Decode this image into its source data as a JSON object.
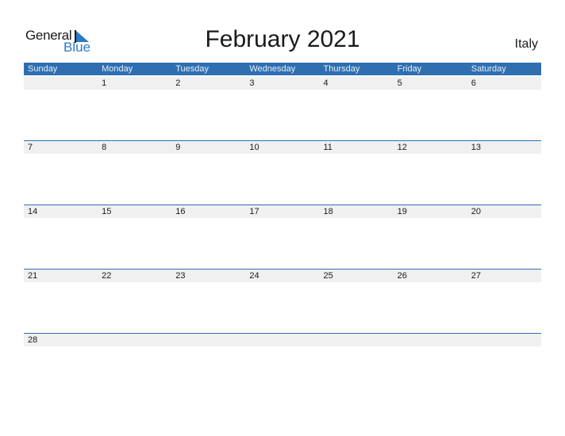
{
  "logo": {
    "general": "General",
    "blue": "Blue"
  },
  "title": "February 2021",
  "country": "Italy",
  "colors": {
    "header": "#2f6fb0",
    "band": "#f0f0f0",
    "logo_blue": "#2a79c4"
  },
  "weekdays": [
    "Sunday",
    "Monday",
    "Tuesday",
    "Wednesday",
    "Thursday",
    "Friday",
    "Saturday"
  ],
  "weeks": [
    [
      "",
      "1",
      "2",
      "3",
      "4",
      "5",
      "6"
    ],
    [
      "7",
      "8",
      "9",
      "10",
      "11",
      "12",
      "13"
    ],
    [
      "14",
      "15",
      "16",
      "17",
      "18",
      "19",
      "20"
    ],
    [
      "21",
      "22",
      "23",
      "24",
      "25",
      "26",
      "27"
    ],
    [
      "28",
      "",
      "",
      "",
      "",
      "",
      ""
    ]
  ]
}
